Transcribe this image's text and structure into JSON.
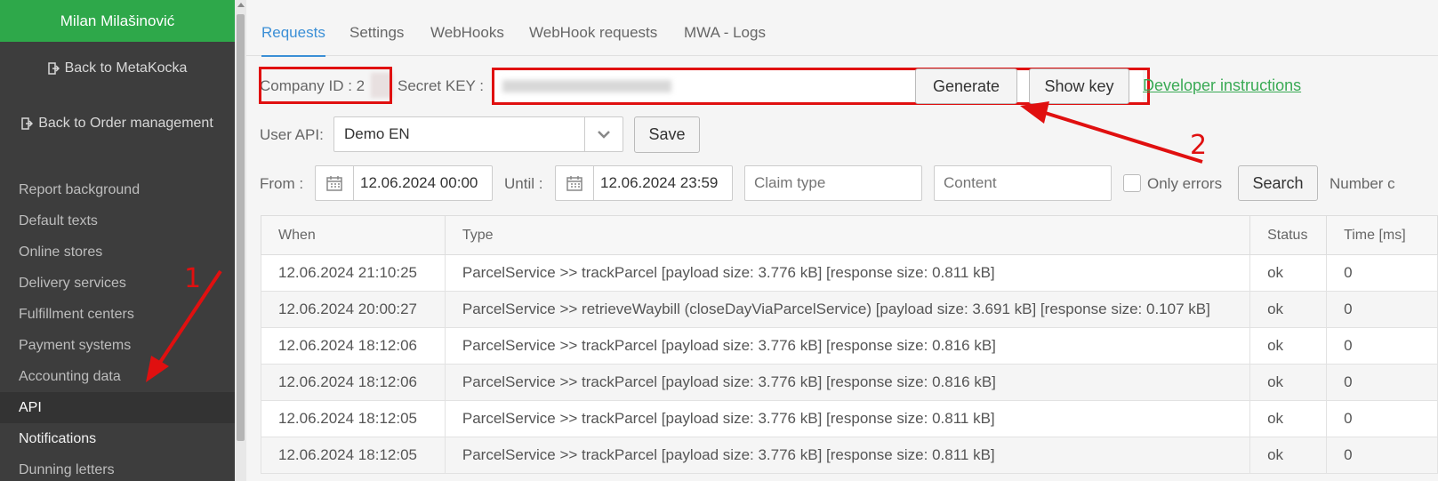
{
  "sidebar": {
    "user_name": "Milan Milašinović",
    "back_links": [
      "Back to MetaKocka",
      "Back to Order management"
    ],
    "items": [
      {
        "label": "Report background"
      },
      {
        "label": "Default texts"
      },
      {
        "label": "Online stores"
      },
      {
        "label": "Delivery services"
      },
      {
        "label": "Fulfillment centers"
      },
      {
        "label": "Payment systems"
      },
      {
        "label": "Accounting data"
      },
      {
        "label": "API"
      },
      {
        "label": "Notifications"
      },
      {
        "label": "Dunning letters"
      }
    ]
  },
  "tabs": [
    "Requests",
    "Settings",
    "WebHooks",
    "WebHook requests",
    "MWA - Logs"
  ],
  "credentials": {
    "company_label": "Company ID : 2",
    "secret_label": "Secret KEY :",
    "generate_label": "Generate",
    "show_key_label": "Show key",
    "developer_link": "Developer instructions"
  },
  "user_api": {
    "label": "User API:",
    "selected": "Demo EN",
    "save_label": "Save"
  },
  "filters": {
    "from_label": "From :",
    "from_value": "12.06.2024 00:00",
    "until_label": "Until :",
    "until_value": "12.06.2024 23:59",
    "claim_placeholder": "Claim type",
    "content_placeholder": "Content",
    "only_errors_label": "Only errors",
    "search_label": "Search",
    "number_label": "Number c"
  },
  "table": {
    "headers": [
      "When",
      "Type",
      "Status",
      "Time [ms]"
    ],
    "rows": [
      [
        "12.06.2024 21:10:25",
        "ParcelService >> trackParcel [payload size: 3.776 kB] [response size: 0.811 kB]",
        "ok",
        "0"
      ],
      [
        "12.06.2024 20:00:27",
        "ParcelService >> retrieveWaybill (closeDayViaParcelService) [payload size: 3.691 kB] [response size: 0.107 kB]",
        "ok",
        "0"
      ],
      [
        "12.06.2024 18:12:06",
        "ParcelService >> trackParcel [payload size: 3.776 kB] [response size: 0.816 kB]",
        "ok",
        "0"
      ],
      [
        "12.06.2024 18:12:06",
        "ParcelService >> trackParcel [payload size: 3.776 kB] [response size: 0.816 kB]",
        "ok",
        "0"
      ],
      [
        "12.06.2024 18:12:05",
        "ParcelService >> trackParcel [payload size: 3.776 kB] [response size: 0.811 kB]",
        "ok",
        "0"
      ],
      [
        "12.06.2024 18:12:05",
        "ParcelService >> trackParcel [payload size: 3.776 kB] [response size: 0.811 kB]",
        "ok",
        "0"
      ]
    ]
  },
  "annotations": {
    "one": "1",
    "two": "2"
  },
  "colors": {
    "accent": "#3b8fd6",
    "brand_green": "#2ea84a",
    "annotation_red": "#e01010"
  }
}
